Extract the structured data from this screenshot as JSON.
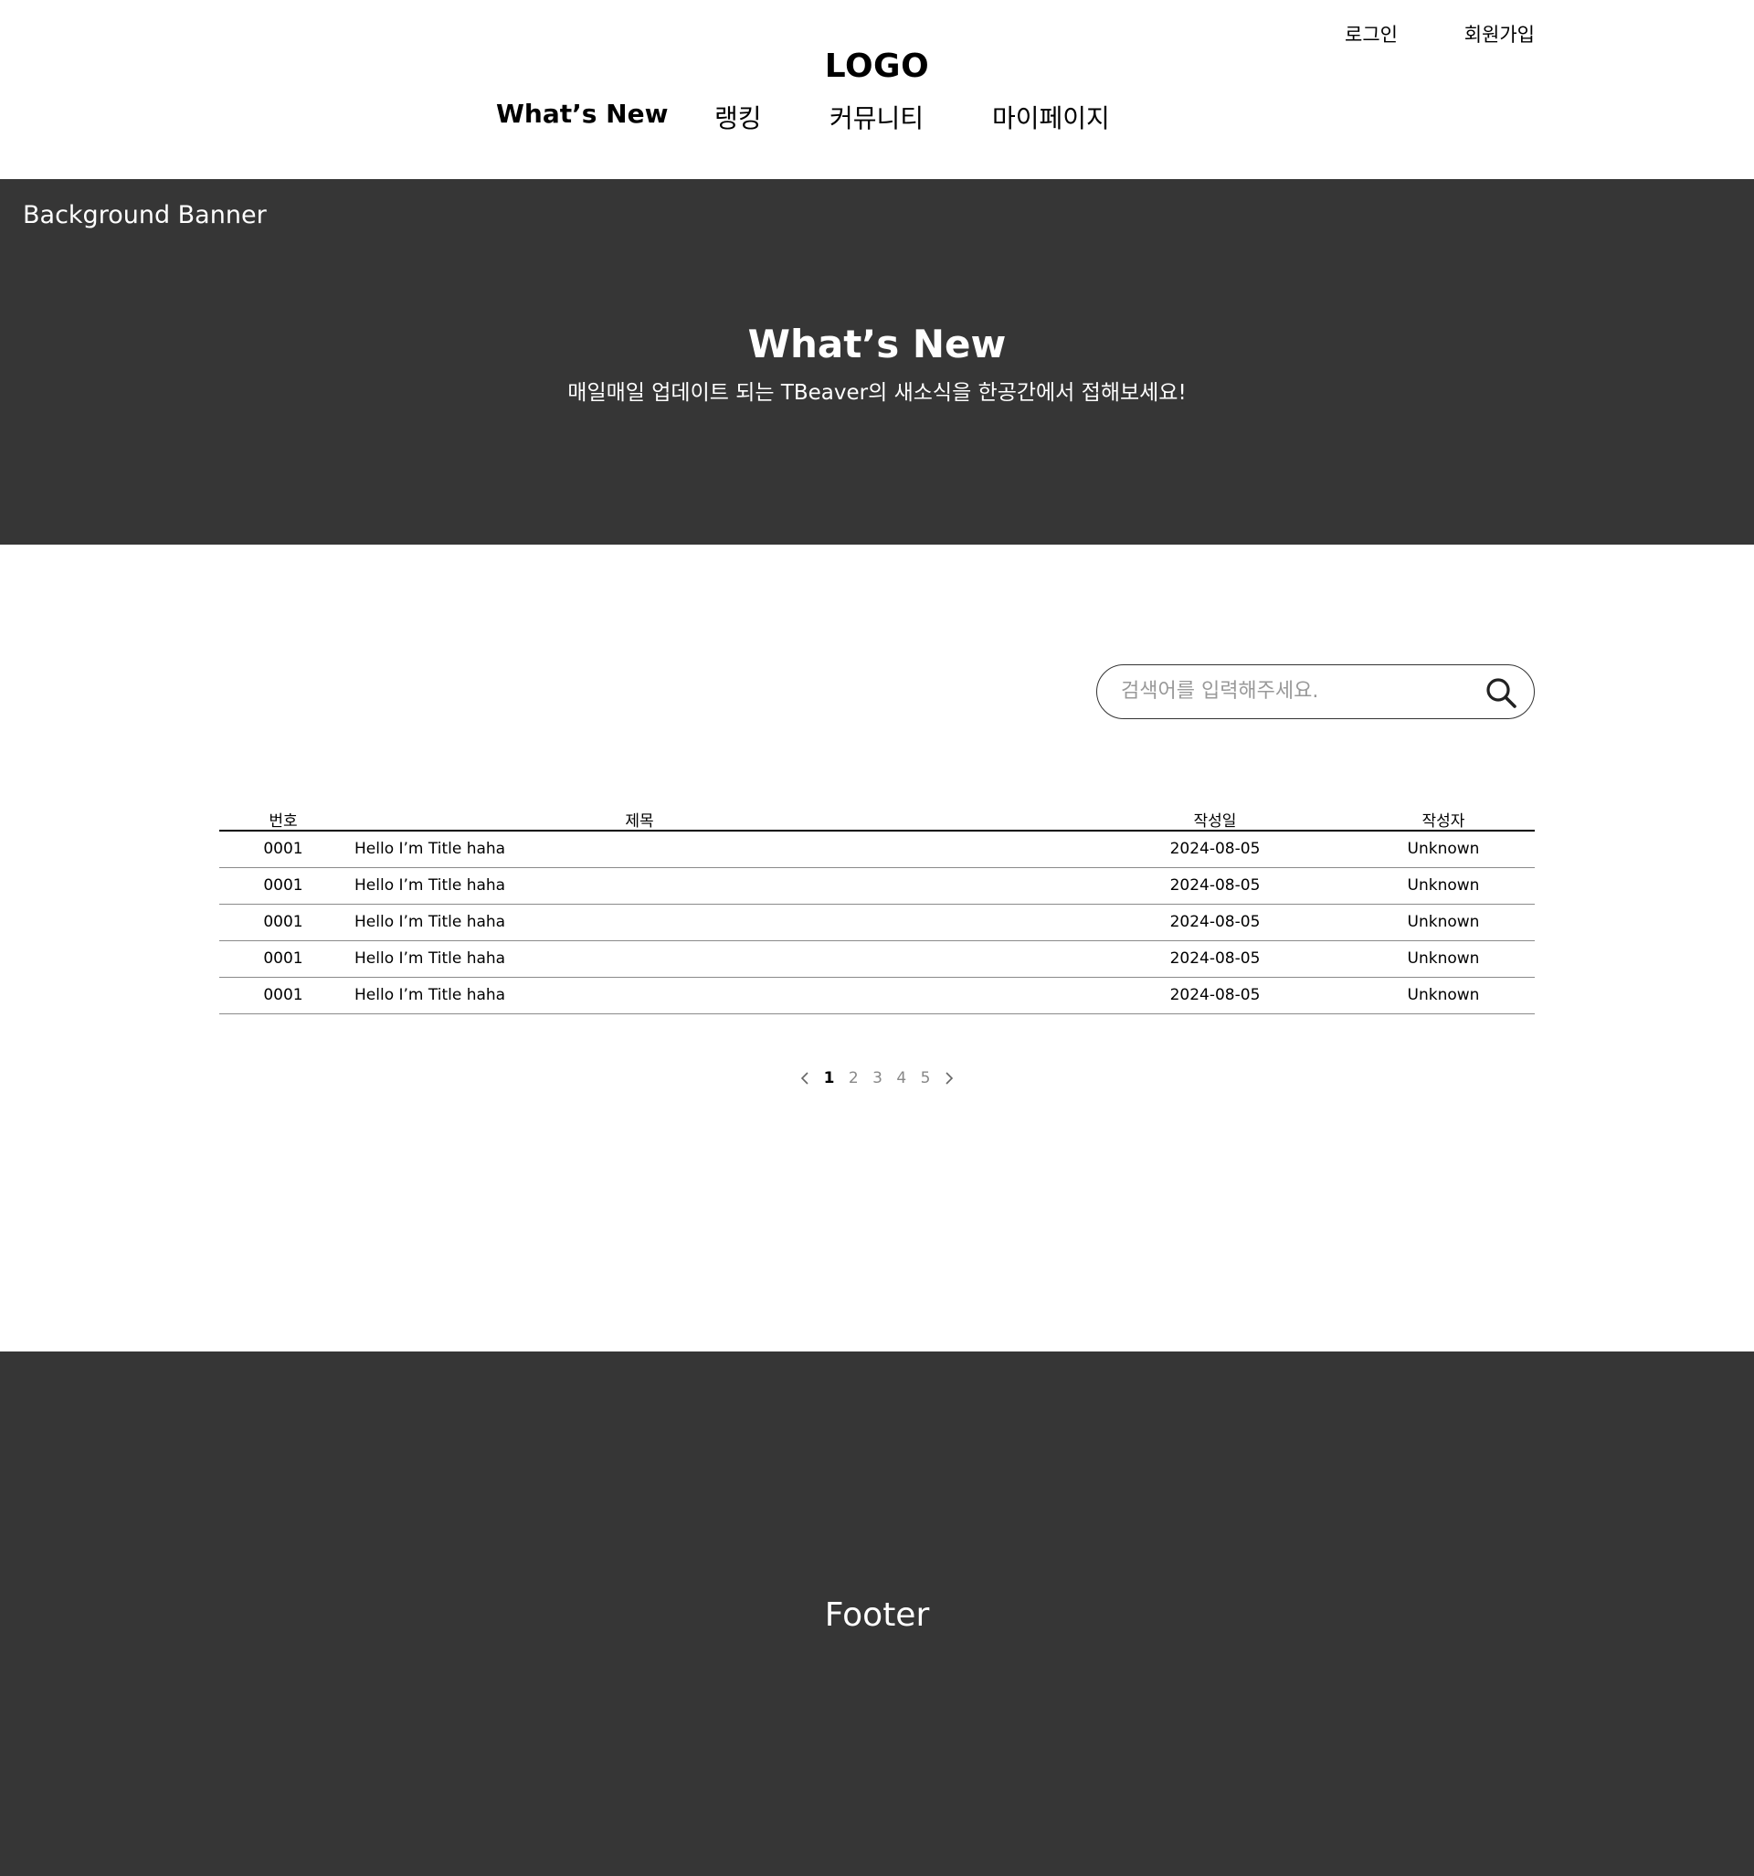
{
  "header": {
    "login_label": "로그인",
    "signup_label": "회원가입",
    "logo": "LOGO",
    "nav": [
      {
        "label": "What’s New"
      },
      {
        "label": "랭킹"
      },
      {
        "label": "커뮤니티"
      },
      {
        "label": "마이페이지"
      }
    ]
  },
  "banner": {
    "label": "Background Banner",
    "title": "What’s New",
    "subtitle": "매일매일 업데이트 되는 TBeaver의 새소식을 한공간에서 접해보세요!"
  },
  "search": {
    "placeholder": "검색어를 입력해주세요.",
    "value": ""
  },
  "board": {
    "columns": {
      "no": "번호",
      "title": "제목",
      "date": "작성일",
      "author": "작성자"
    },
    "rows": [
      {
        "no": "0001",
        "title": "Hello I’m Title haha",
        "date": "2024-08-05",
        "author": "Unknown"
      },
      {
        "no": "0001",
        "title": "Hello I’m Title haha",
        "date": "2024-08-05",
        "author": "Unknown"
      },
      {
        "no": "0001",
        "title": "Hello I’m Title haha",
        "date": "2024-08-05",
        "author": "Unknown"
      },
      {
        "no": "0001",
        "title": "Hello I’m Title haha",
        "date": "2024-08-05",
        "author": "Unknown"
      },
      {
        "no": "0001",
        "title": "Hello I’m Title haha",
        "date": "2024-08-05",
        "author": "Unknown"
      }
    ]
  },
  "pagination": {
    "pages": [
      "1",
      "2",
      "3",
      "4",
      "5"
    ],
    "current": "1"
  },
  "footer": {
    "label": "Footer"
  },
  "colors": {
    "banner_bg": "#363636",
    "footer_bg": "#363636",
    "text": "#000000",
    "muted": "#888888"
  }
}
